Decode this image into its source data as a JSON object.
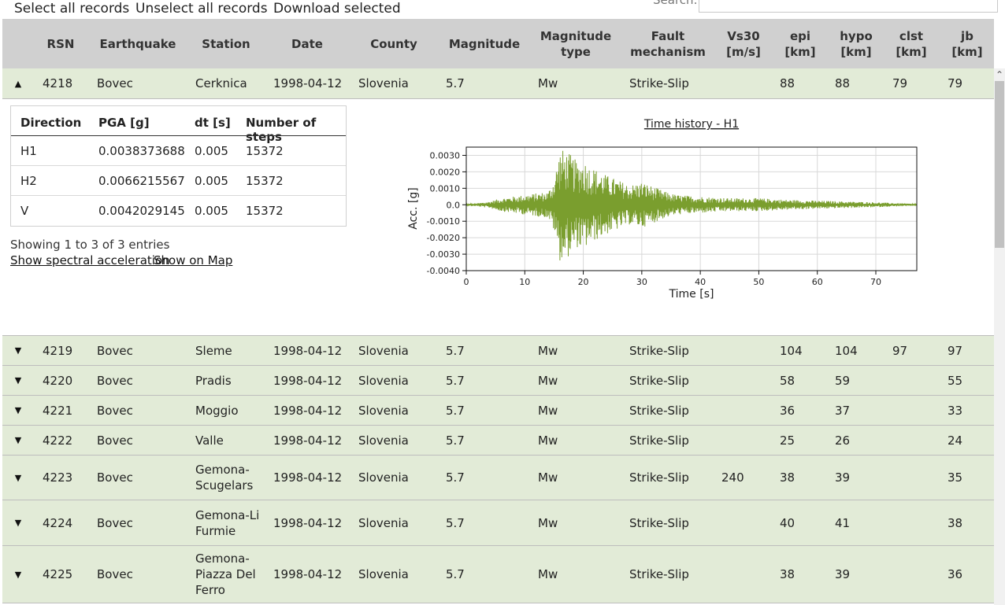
{
  "toolbar": {
    "select_all": "Select all records",
    "unselect_all": "Unselect all records",
    "download": "Download selected",
    "search_label": "Search:",
    "search_value": ""
  },
  "columns": [
    "RSN",
    "Earthquake",
    "Station",
    "Date",
    "County",
    "Magnitude",
    "Magnitude type",
    "Fault mechanism",
    "Vs30 [m/s]",
    "epi [km]",
    "hypo [km]",
    "clst [km]",
    "jb [km]"
  ],
  "expanded_row": {
    "rsn": "4218",
    "earthquake": "Bovec",
    "station": "Cerknica",
    "date": "1998-04-12",
    "county": "Slovenia",
    "magnitude": "5.7",
    "mag_type": "Mw",
    "fault": "Strike-Slip",
    "vs30": "",
    "epi": "88",
    "hypo": "88",
    "clst": "79",
    "jb": "79"
  },
  "detail": {
    "headers": [
      "Direction",
      "PGA [g]",
      "dt [s]",
      "Number of steps"
    ],
    "rows": [
      {
        "dir": "H1",
        "pga": "0.0038373688",
        "dt": "0.005",
        "steps": "15372"
      },
      {
        "dir": "H2",
        "pga": "0.0066215567",
        "dt": "0.005",
        "steps": "15372"
      },
      {
        "dir": "V",
        "pga": "0.0042029145",
        "dt": "0.005",
        "steps": "15372"
      }
    ],
    "info": "Showing 1 to 3 of 3 entries",
    "link_spectral": "Show spectral acceleration",
    "link_map": "Show on Map"
  },
  "rows": [
    {
      "rsn": "4219",
      "earthquake": "Bovec",
      "station": "Sleme",
      "date": "1998-04-12",
      "county": "Slovenia",
      "magnitude": "5.7",
      "mag_type": "Mw",
      "fault": "Strike-Slip",
      "vs30": "",
      "epi": "104",
      "hypo": "104",
      "clst": "97",
      "jb": "97"
    },
    {
      "rsn": "4220",
      "earthquake": "Bovec",
      "station": "Pradis",
      "date": "1998-04-12",
      "county": "Slovenia",
      "magnitude": "5.7",
      "mag_type": "Mw",
      "fault": "Strike-Slip",
      "vs30": "",
      "epi": "58",
      "hypo": "59",
      "clst": "",
      "jb": "55"
    },
    {
      "rsn": "4221",
      "earthquake": "Bovec",
      "station": "Moggio",
      "date": "1998-04-12",
      "county": "Slovenia",
      "magnitude": "5.7",
      "mag_type": "Mw",
      "fault": "Strike-Slip",
      "vs30": "",
      "epi": "36",
      "hypo": "37",
      "clst": "",
      "jb": "33"
    },
    {
      "rsn": "4222",
      "earthquake": "Bovec",
      "station": "Valle",
      "date": "1998-04-12",
      "county": "Slovenia",
      "magnitude": "5.7",
      "mag_type": "Mw",
      "fault": "Strike-Slip",
      "vs30": "",
      "epi": "25",
      "hypo": "26",
      "clst": "",
      "jb": "24"
    },
    {
      "rsn": "4223",
      "earthquake": "Bovec",
      "station": "Gemona-Scugelars",
      "station_lines": [
        "Gemona-",
        "Scugelars"
      ],
      "date": "1998-04-12",
      "county": "Slovenia",
      "magnitude": "5.7",
      "mag_type": "Mw",
      "fault": "Strike-Slip",
      "vs30": "240",
      "epi": "38",
      "hypo": "39",
      "clst": "",
      "jb": "35"
    },
    {
      "rsn": "4224",
      "earthquake": "Bovec",
      "station": "Gemona-Li Furmie",
      "station_lines": [
        "Gemona-Li",
        "Furmie"
      ],
      "date": "1998-04-12",
      "county": "Slovenia",
      "magnitude": "5.7",
      "mag_type": "Mw",
      "fault": "Strike-Slip",
      "vs30": "",
      "epi": "40",
      "hypo": "41",
      "clst": "",
      "jb": "38"
    },
    {
      "rsn": "4225",
      "earthquake": "Bovec",
      "station": "Gemona-Piazza Del Ferro",
      "station_lines": [
        "Gemona-",
        "Piazza Del",
        "Ferro"
      ],
      "date": "1998-04-12",
      "county": "Slovenia",
      "magnitude": "5.7",
      "mag_type": "Mw",
      "fault": "Strike-Slip",
      "vs30": "",
      "epi": "38",
      "hypo": "39",
      "clst": "",
      "jb": "36"
    }
  ],
  "colors": {
    "row_bg": "#e2ebd7",
    "header_bg": "#d0d0d0",
    "trace": "#7a9e2e"
  },
  "chart_data": {
    "type": "line",
    "title": "Time history - H1",
    "xlabel": "Time [s]",
    "ylabel": "Acc. [g]",
    "xlim": [
      0,
      77
    ],
    "ylim": [
      -0.004,
      0.0035
    ],
    "xticks": [
      0,
      10,
      20,
      30,
      40,
      50,
      60,
      70
    ],
    "yticks": [
      0.003,
      0.002,
      0.001,
      0.0,
      -0.001,
      -0.002,
      -0.003,
      -0.004
    ],
    "ytick_labels": [
      "0.0030",
      "0.0020",
      "0.0010",
      "0.0",
      "-0.0010",
      "-0.0020",
      "-0.0030",
      "-0.0040"
    ],
    "grid": true,
    "series": [
      {
        "envelope": [
          [
            0,
            5e-05
          ],
          [
            2,
            0.0001
          ],
          [
            4,
            0.0002
          ],
          [
            6,
            0.0004
          ],
          [
            8,
            0.0005
          ],
          [
            10,
            0.0006
          ],
          [
            12,
            0.0007
          ],
          [
            14,
            0.0008
          ],
          [
            15,
            0.0016
          ],
          [
            16,
            0.0034
          ],
          [
            17,
            0.0033
          ],
          [
            18,
            0.003
          ],
          [
            19,
            0.0026
          ],
          [
            20,
            0.0028
          ],
          [
            21,
            0.0024
          ],
          [
            22,
            0.0022
          ],
          [
            24,
            0.0018
          ],
          [
            26,
            0.0015
          ],
          [
            28,
            0.0012
          ],
          [
            30,
            0.0014
          ],
          [
            32,
            0.0011
          ],
          [
            34,
            0.0008
          ],
          [
            36,
            0.0006
          ],
          [
            40,
            0.0005
          ],
          [
            45,
            0.0004
          ],
          [
            50,
            0.0004
          ],
          [
            55,
            0.0003
          ],
          [
            60,
            0.00025
          ],
          [
            65,
            0.0002
          ],
          [
            70,
            0.00015
          ],
          [
            77,
            5e-05
          ]
        ]
      }
    ]
  }
}
